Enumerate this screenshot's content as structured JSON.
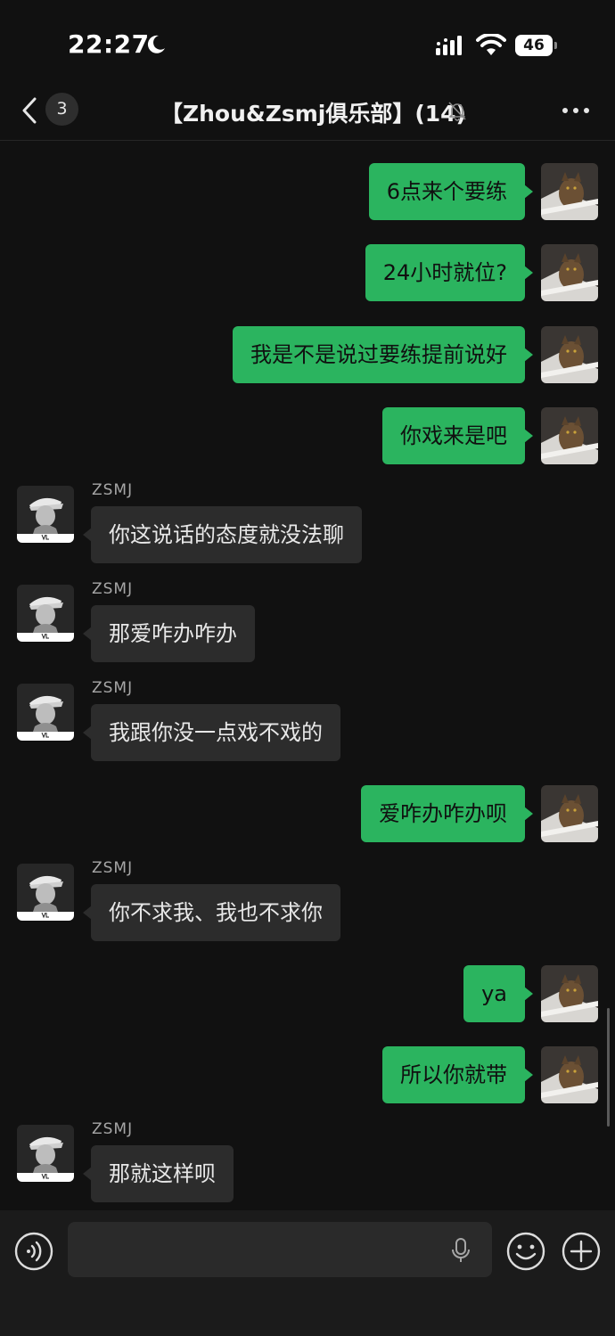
{
  "status_bar": {
    "time": "22:27",
    "battery": "46"
  },
  "header": {
    "back_count": "3",
    "title": "【Zhou&Zsmj俱乐部】(14)"
  },
  "messages": [
    {
      "direction": "out",
      "text": "6点来个要练"
    },
    {
      "direction": "out",
      "text": "24小时就位?"
    },
    {
      "direction": "out",
      "text": "我是不是说过要练提前说好"
    },
    {
      "direction": "out",
      "text": "你戏来是吧"
    },
    {
      "direction": "in",
      "sender": "ZSMJ",
      "text": "你这说话的态度就没法聊"
    },
    {
      "direction": "in",
      "sender": "ZSMJ",
      "text": "那爱咋办咋办"
    },
    {
      "direction": "in",
      "sender": "ZSMJ",
      "text": "我跟你没一点戏不戏的"
    },
    {
      "direction": "out",
      "text": "爱咋办咋办呗"
    },
    {
      "direction": "in",
      "sender": "ZSMJ",
      "text": "你不求我、我也不求你"
    },
    {
      "direction": "out",
      "text": "ya"
    },
    {
      "direction": "out",
      "text": "所以你就带"
    },
    {
      "direction": "in",
      "sender": "ZSMJ",
      "text": "那就这样呗"
    }
  ],
  "input": {
    "value": "",
    "placeholder": ""
  },
  "icons": {
    "voice": "voice-icon",
    "mic": "mic-icon",
    "emoji": "emoji-icon",
    "plus": "plus-icon",
    "back": "chevron-left-icon",
    "mute": "bell-off-icon",
    "more": "more-icon"
  },
  "colors": {
    "background": "#111111",
    "outgoing_bubble": "#2bb45f",
    "incoming_bubble": "#2c2c2c",
    "sender_name": "#a6a6a6"
  }
}
